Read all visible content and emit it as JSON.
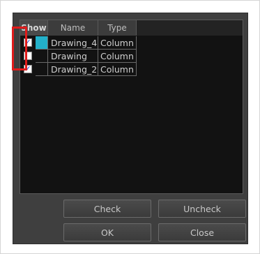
{
  "table": {
    "headers": {
      "show": "Show",
      "name": "Name",
      "type": "Type"
    },
    "rows": [
      {
        "checked": true,
        "check_mark": "✓",
        "color": "#23b0c9",
        "name": "Drawing_4",
        "type": "Column"
      },
      {
        "checked": false,
        "check_mark": "",
        "color": "",
        "name": "Drawing",
        "type": "Column"
      },
      {
        "checked": true,
        "check_mark": "✓",
        "color": "",
        "name": "Drawing_2",
        "type": "Column"
      }
    ]
  },
  "buttons": {
    "check": "Check",
    "uncheck": "Uncheck",
    "ok": "OK",
    "close": "Close"
  },
  "colors": {
    "dialog_bg": "#3f3f3f",
    "table_bg": "#121212",
    "highlight": "#e01b1b",
    "check_mark": "#1f3fd0"
  }
}
